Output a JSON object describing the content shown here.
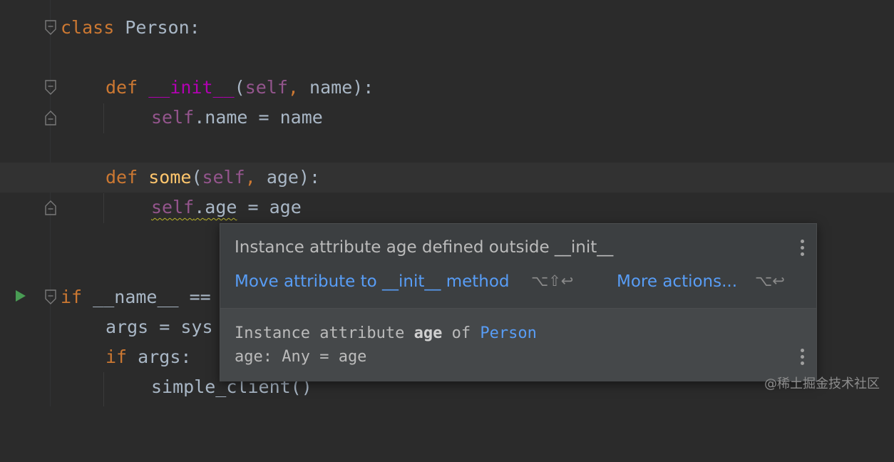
{
  "editor": {
    "line1": {
      "kw": "class",
      "name": " Person",
      "colon": ":"
    },
    "line2": {
      "kw": "def",
      "magic": "__init__",
      "open": "(",
      "self": "self",
      "comma": ",",
      "params": " name):"
    },
    "line3": {
      "self": "self",
      "rest": ".name = name"
    },
    "line4": {
      "kw": "def",
      "fn": "some",
      "open": "(",
      "self": "self",
      "comma": ",",
      "params": " age):"
    },
    "line5": {
      "self": "self",
      "dot": ".",
      "attr": "age",
      "rest": " = age"
    },
    "line6": {
      "kw": "if",
      "rest": " __name__ =="
    },
    "line7": {
      "text": "args = sys"
    },
    "line8": {
      "kw": "if",
      "rest": " args:"
    },
    "line9": {
      "text": "simple_client()"
    }
  },
  "popup": {
    "title": "Instance attribute age defined outside __init__",
    "action_primary": "Move attribute to __init__ method",
    "action_primary_shortcut": "⌥⇧↩",
    "action_more": "More actions...",
    "action_more_shortcut": "⌥↩",
    "doc_prefix": "Instance attribute ",
    "doc_attr": "age",
    "doc_of": " of ",
    "doc_class": "Person",
    "doc_signature": "age: Any = age"
  },
  "watermark": "@稀土掘金技术社区",
  "colors": {
    "background": "#2b2b2b",
    "keyword": "#cc7832",
    "self": "#94558d",
    "function": "#ffc66d",
    "link": "#589df6",
    "popup_bg": "#3c3f41"
  }
}
